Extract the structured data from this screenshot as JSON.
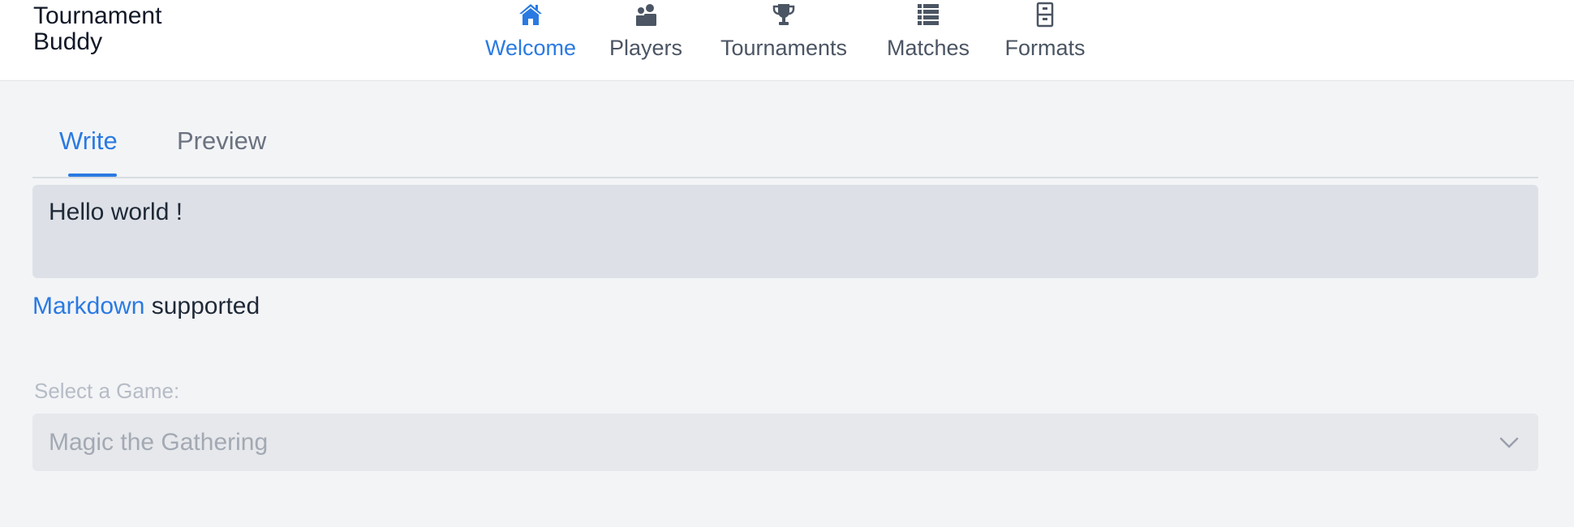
{
  "app": {
    "brand_line1": "Tournament",
    "brand_line2": "Buddy"
  },
  "nav": {
    "items": [
      {
        "label": "Welcome",
        "icon": "home-icon",
        "active": true
      },
      {
        "label": "Players",
        "icon": "users-icon",
        "active": false
      },
      {
        "label": "Tournaments",
        "icon": "trophy-icon",
        "active": false
      },
      {
        "label": "Matches",
        "icon": "list-icon",
        "active": false
      },
      {
        "label": "Formats",
        "icon": "archive-icon",
        "active": false
      }
    ]
  },
  "editor_tabs": {
    "write": "Write",
    "preview": "Preview",
    "active": "write"
  },
  "editor": {
    "content": "Hello world !"
  },
  "markdown_note": {
    "link_text": "Markdown",
    "rest_text": " supported"
  },
  "game_select": {
    "label": "Select a Game:",
    "value": "Magic the Gathering",
    "disabled": true
  },
  "colors": {
    "accent": "#2a7ae2",
    "nav_text": "#4b5563",
    "page_bg": "#f3f4f6",
    "editor_bg": "#dde1e7"
  }
}
